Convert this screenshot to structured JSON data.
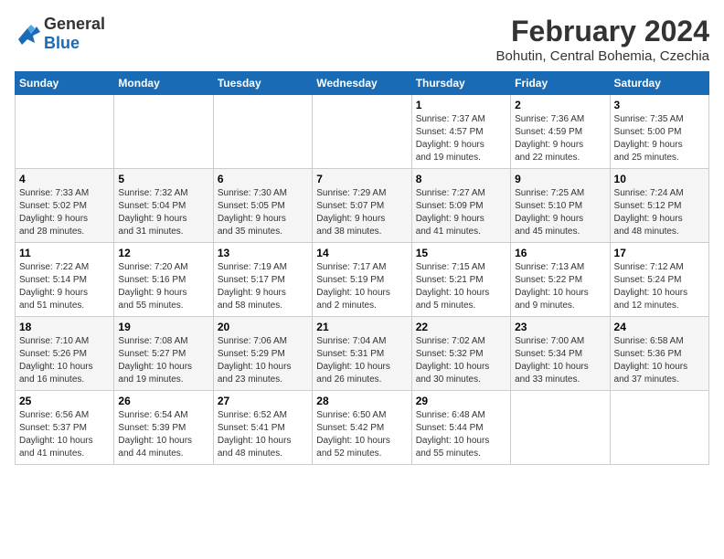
{
  "header": {
    "logo_line1": "General",
    "logo_line2": "Blue",
    "month_year": "February 2024",
    "location": "Bohutin, Central Bohemia, Czechia"
  },
  "weekdays": [
    "Sunday",
    "Monday",
    "Tuesday",
    "Wednesday",
    "Thursday",
    "Friday",
    "Saturday"
  ],
  "weeks": [
    [
      {
        "day": "",
        "info": ""
      },
      {
        "day": "",
        "info": ""
      },
      {
        "day": "",
        "info": ""
      },
      {
        "day": "",
        "info": ""
      },
      {
        "day": "1",
        "info": "Sunrise: 7:37 AM\nSunset: 4:57 PM\nDaylight: 9 hours\nand 19 minutes."
      },
      {
        "day": "2",
        "info": "Sunrise: 7:36 AM\nSunset: 4:59 PM\nDaylight: 9 hours\nand 22 minutes."
      },
      {
        "day": "3",
        "info": "Sunrise: 7:35 AM\nSunset: 5:00 PM\nDaylight: 9 hours\nand 25 minutes."
      }
    ],
    [
      {
        "day": "4",
        "info": "Sunrise: 7:33 AM\nSunset: 5:02 PM\nDaylight: 9 hours\nand 28 minutes."
      },
      {
        "day": "5",
        "info": "Sunrise: 7:32 AM\nSunset: 5:04 PM\nDaylight: 9 hours\nand 31 minutes."
      },
      {
        "day": "6",
        "info": "Sunrise: 7:30 AM\nSunset: 5:05 PM\nDaylight: 9 hours\nand 35 minutes."
      },
      {
        "day": "7",
        "info": "Sunrise: 7:29 AM\nSunset: 5:07 PM\nDaylight: 9 hours\nand 38 minutes."
      },
      {
        "day": "8",
        "info": "Sunrise: 7:27 AM\nSunset: 5:09 PM\nDaylight: 9 hours\nand 41 minutes."
      },
      {
        "day": "9",
        "info": "Sunrise: 7:25 AM\nSunset: 5:10 PM\nDaylight: 9 hours\nand 45 minutes."
      },
      {
        "day": "10",
        "info": "Sunrise: 7:24 AM\nSunset: 5:12 PM\nDaylight: 9 hours\nand 48 minutes."
      }
    ],
    [
      {
        "day": "11",
        "info": "Sunrise: 7:22 AM\nSunset: 5:14 PM\nDaylight: 9 hours\nand 51 minutes."
      },
      {
        "day": "12",
        "info": "Sunrise: 7:20 AM\nSunset: 5:16 PM\nDaylight: 9 hours\nand 55 minutes."
      },
      {
        "day": "13",
        "info": "Sunrise: 7:19 AM\nSunset: 5:17 PM\nDaylight: 9 hours\nand 58 minutes."
      },
      {
        "day": "14",
        "info": "Sunrise: 7:17 AM\nSunset: 5:19 PM\nDaylight: 10 hours\nand 2 minutes."
      },
      {
        "day": "15",
        "info": "Sunrise: 7:15 AM\nSunset: 5:21 PM\nDaylight: 10 hours\nand 5 minutes."
      },
      {
        "day": "16",
        "info": "Sunrise: 7:13 AM\nSunset: 5:22 PM\nDaylight: 10 hours\nand 9 minutes."
      },
      {
        "day": "17",
        "info": "Sunrise: 7:12 AM\nSunset: 5:24 PM\nDaylight: 10 hours\nand 12 minutes."
      }
    ],
    [
      {
        "day": "18",
        "info": "Sunrise: 7:10 AM\nSunset: 5:26 PM\nDaylight: 10 hours\nand 16 minutes."
      },
      {
        "day": "19",
        "info": "Sunrise: 7:08 AM\nSunset: 5:27 PM\nDaylight: 10 hours\nand 19 minutes."
      },
      {
        "day": "20",
        "info": "Sunrise: 7:06 AM\nSunset: 5:29 PM\nDaylight: 10 hours\nand 23 minutes."
      },
      {
        "day": "21",
        "info": "Sunrise: 7:04 AM\nSunset: 5:31 PM\nDaylight: 10 hours\nand 26 minutes."
      },
      {
        "day": "22",
        "info": "Sunrise: 7:02 AM\nSunset: 5:32 PM\nDaylight: 10 hours\nand 30 minutes."
      },
      {
        "day": "23",
        "info": "Sunrise: 7:00 AM\nSunset: 5:34 PM\nDaylight: 10 hours\nand 33 minutes."
      },
      {
        "day": "24",
        "info": "Sunrise: 6:58 AM\nSunset: 5:36 PM\nDaylight: 10 hours\nand 37 minutes."
      }
    ],
    [
      {
        "day": "25",
        "info": "Sunrise: 6:56 AM\nSunset: 5:37 PM\nDaylight: 10 hours\nand 41 minutes."
      },
      {
        "day": "26",
        "info": "Sunrise: 6:54 AM\nSunset: 5:39 PM\nDaylight: 10 hours\nand 44 minutes."
      },
      {
        "day": "27",
        "info": "Sunrise: 6:52 AM\nSunset: 5:41 PM\nDaylight: 10 hours\nand 48 minutes."
      },
      {
        "day": "28",
        "info": "Sunrise: 6:50 AM\nSunset: 5:42 PM\nDaylight: 10 hours\nand 52 minutes."
      },
      {
        "day": "29",
        "info": "Sunrise: 6:48 AM\nSunset: 5:44 PM\nDaylight: 10 hours\nand 55 minutes."
      },
      {
        "day": "",
        "info": ""
      },
      {
        "day": "",
        "info": ""
      }
    ]
  ]
}
